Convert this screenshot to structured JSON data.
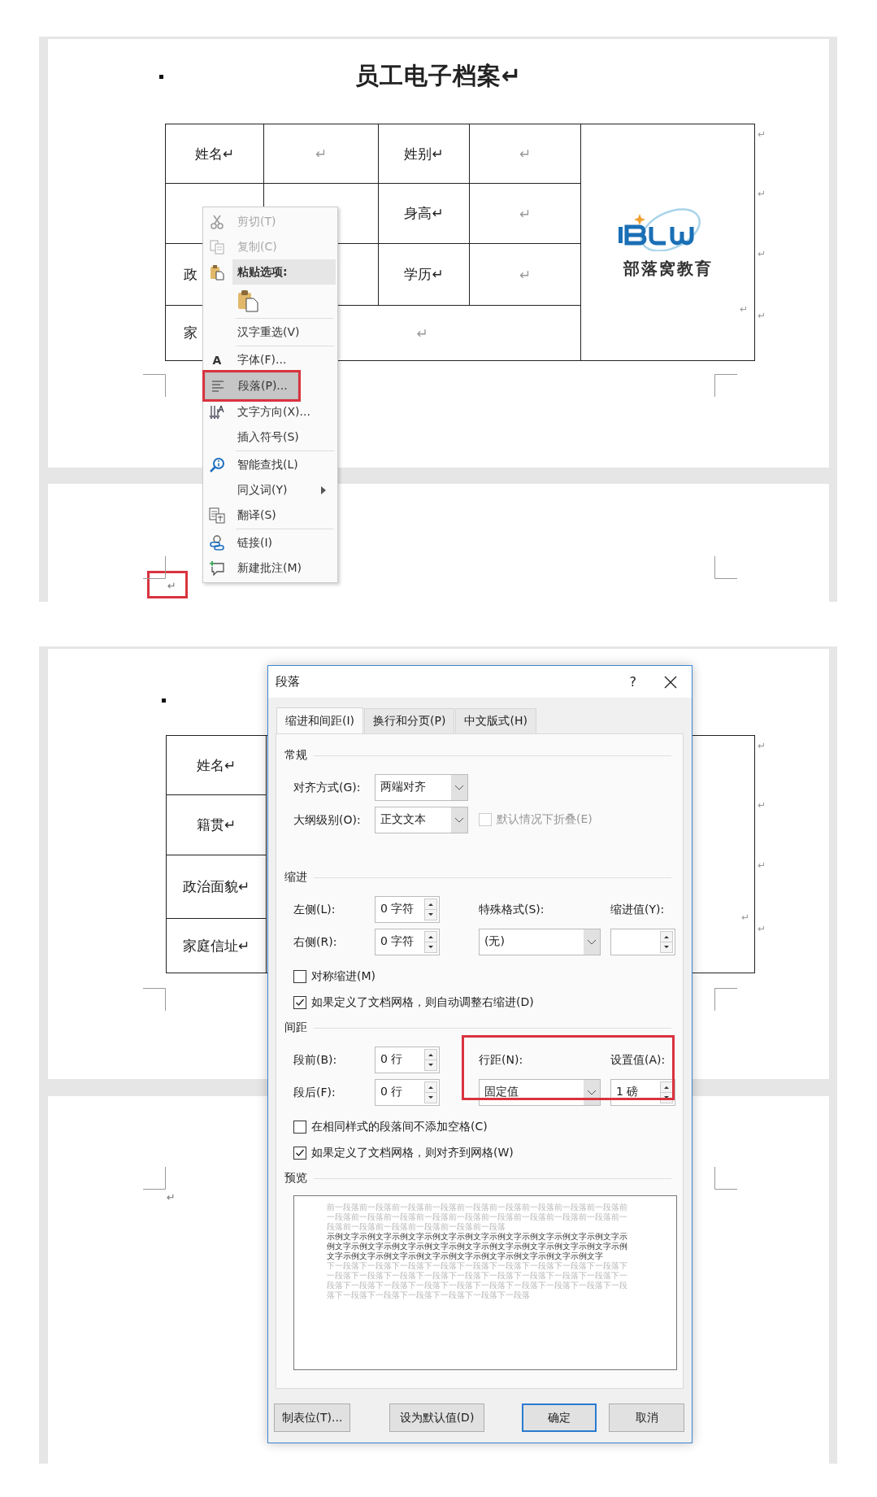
{
  "doc_top": {
    "title": "员工电子档案↵",
    "table": {
      "rows": [
        {
          "cells": [
            {
              "text": "姓名↵"
            },
            {
              "text": "↵"
            },
            {
              "text": "姓别↵"
            },
            {
              "text": "↵"
            }
          ],
          "end_mark": "↵"
        },
        {
          "cells": [
            {},
            {},
            {
              "text": "身高↵"
            },
            {
              "text": "↵"
            }
          ],
          "end_mark": "↵"
        },
        {
          "cells": [
            {
              "text": "政",
              "clipped": true
            },
            {},
            {
              "text": "学历↵"
            },
            {
              "text": "↵"
            }
          ],
          "end_mark": "↵"
        },
        {
          "cells": [
            {
              "text": "家",
              "clipped": true
            },
            {
              "text": "↵",
              "colspan": 3
            }
          ],
          "end_mark": "↵"
        }
      ],
      "logo": {
        "text": "部落窝教育",
        "end_mark": "↵"
      }
    },
    "next_page_mark": {
      "text": "↵",
      "annotated": true
    }
  },
  "context_menu": {
    "items": [
      {
        "kind": "item",
        "label": "剪切(T)",
        "disabled": true,
        "selected": false
      },
      {
        "kind": "item",
        "label": "复制(C)",
        "disabled": true,
        "selected": false
      },
      {
        "kind": "header",
        "label": "粘贴选项:"
      },
      {
        "kind": "paste-option"
      },
      {
        "kind": "separator"
      },
      {
        "kind": "item",
        "label": "汉字重选(V)",
        "disabled": false,
        "selected": false
      },
      {
        "kind": "separator"
      },
      {
        "kind": "item",
        "label": "字体(F)...",
        "icon_text": "A",
        "disabled": false,
        "selected": false
      },
      {
        "kind": "item",
        "label": "段落(P)...",
        "disabled": false,
        "selected": true,
        "annotated": true
      },
      {
        "kind": "item",
        "label": "文字方向(X)...",
        "disabled": false,
        "selected": false
      },
      {
        "kind": "item",
        "label": "插入符号(S)",
        "disabled": false,
        "selected": false
      },
      {
        "kind": "separator"
      },
      {
        "kind": "item",
        "label": "智能查找(L)",
        "disabled": false,
        "selected": false
      },
      {
        "kind": "item",
        "label": "同义词(Y)",
        "disabled": false,
        "selected": false,
        "submenu": true
      },
      {
        "kind": "item",
        "label": "翻译(S)",
        "disabled": false,
        "selected": false
      },
      {
        "kind": "separator"
      },
      {
        "kind": "item",
        "label": "链接(I)",
        "disabled": false,
        "selected": false
      },
      {
        "kind": "item",
        "label": "新建批注(M)",
        "disabled": false,
        "selected": false
      }
    ]
  },
  "doc_bottom": {
    "table": {
      "rows": [
        {
          "text": "姓名↵",
          "end_mark": "↵"
        },
        {
          "text": "籍贯↵",
          "end_mark": "↵"
        },
        {
          "text": "政治面貌↵",
          "end_mark": "↵"
        },
        {
          "text": "家庭信址↵",
          "end_mark": "↵"
        }
      ],
      "logo_end_mark": "↵"
    },
    "next_page_mark": {
      "text": "↵",
      "annotated": false
    }
  },
  "dialog": {
    "title": "段落",
    "help": "?",
    "tabs": [
      {
        "label": "缩进和间距(I)",
        "selected": true
      },
      {
        "label": "换行和分页(P)",
        "selected": false
      },
      {
        "label": "中文版式(H)",
        "selected": false
      }
    ],
    "sections": [
      {
        "heading": "常规",
        "rows": [
          [
            {
              "kind": "label",
              "text": "对齐方式(G):"
            },
            {
              "kind": "select",
              "value": "两端对齐"
            }
          ],
          [
            {
              "kind": "label",
              "text": "大纲级别(O):"
            },
            {
              "kind": "select",
              "value": "正文文本"
            },
            {
              "kind": "checkbox",
              "label": "默认情况下折叠(E)",
              "checked": false,
              "disabled": true
            }
          ]
        ]
      },
      {
        "heading": "缩进",
        "rows": [
          [
            {
              "kind": "label",
              "text": "左侧(L):"
            },
            {
              "kind": "spin",
              "value": "0 字符"
            },
            {
              "kind": "label",
              "text": "特殊格式(S):"
            },
            {
              "kind": "label",
              "text": "缩进值(Y):"
            }
          ],
          [
            {
              "kind": "label",
              "text": "右侧(R):"
            },
            {
              "kind": "spin",
              "value": "0 字符"
            },
            {
              "kind": "select",
              "value": "(无)"
            },
            {
              "kind": "spin"
            }
          ],
          [
            {
              "kind": "checkbox",
              "label": "对称缩进(M)",
              "checked": false,
              "disabled": false
            }
          ],
          [
            {
              "kind": "checkbox",
              "label": "如果定义了文档网格，则自动调整右缩进(D)",
              "checked": true,
              "disabled": false
            }
          ]
        ]
      },
      {
        "heading": "间距",
        "annotated": true,
        "rows": [
          [
            {
              "kind": "label",
              "text": "段前(B):"
            },
            {
              "kind": "spin",
              "value": "0 行"
            },
            {
              "kind": "label",
              "text": "行距(N):"
            },
            {
              "kind": "label",
              "text": "设置值(A):"
            }
          ],
          [
            {
              "kind": "label",
              "text": "段后(F):"
            },
            {
              "kind": "spin",
              "value": "0 行"
            },
            {
              "kind": "select",
              "value": "固定值"
            },
            {
              "kind": "spin",
              "value": "1 磅"
            }
          ],
          [
            {
              "kind": "checkbox",
              "label": "在相同样式的段落间不添加空格(C)",
              "checked": false,
              "disabled": false
            }
          ],
          [
            {
              "kind": "checkbox",
              "label": "如果定义了文档网格，则对齐到网格(W)",
              "checked": true,
              "disabled": false
            }
          ]
        ]
      }
    ],
    "preview": {
      "heading": "预览",
      "paragraphs": [
        {
          "kind": "previous",
          "text": "前一段落前一段落前一段落前一段落前一段落前一段落前一段落前一段落前一段落前一段落前一段落前一段落前一段落前一段落前一段落前一段落前一段落前一段落前一段落前一段落前一段落前一段落前一段落前一段落"
        },
        {
          "kind": "sample",
          "text": "示例文字示例文字示例文字示例文字示例文字示例文字示例文字示例文字示例文字示例文字示例文字示例文字示例文字示例文字示例文字示例文字示例文字示例文字示例文字示例文字示例文字示例文字示例文字示例文字示例文字示例文字示例文字"
        },
        {
          "kind": "next",
          "text": "下一段落下一段落下一段落下一段落下一段落下一段落下一段落下一段落下一段落下一段落下一段落下一段落下一段落下一段落下一段落下一段落下一段落下一段落下一段落下一段落下一段落下一段落下一段落下一段落下一段落下一段落下一段落下一段落下一段落下一段落下一段落下一段落下一段落下一段落"
        }
      ]
    },
    "buttons": [
      {
        "label": "制表位(T)...",
        "default": false
      },
      {
        "label": "设为默认值(D)",
        "default": false
      },
      {
        "label": "确定",
        "default": true
      },
      {
        "label": "取消",
        "default": false
      }
    ]
  }
}
